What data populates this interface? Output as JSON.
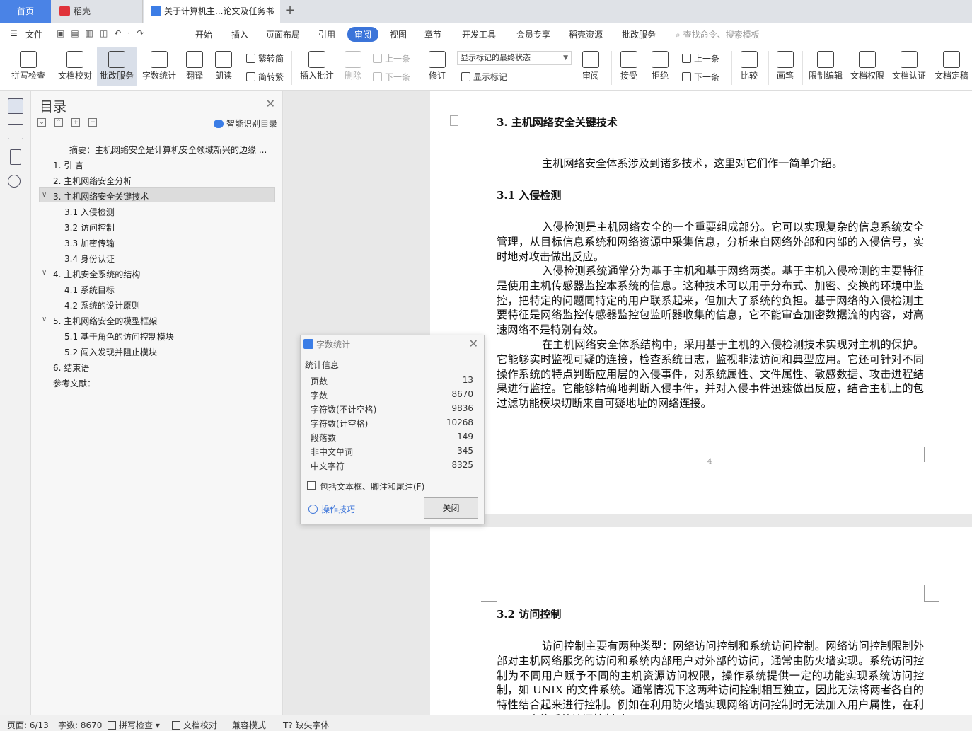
{
  "tabs": {
    "home": "首页",
    "daoke": "稻壳",
    "doc": "关于计算机主...论文及任务书",
    "close": "✕",
    "add": "+"
  },
  "menu": {
    "file": "文件",
    "items": [
      "开始",
      "插入",
      "页面布局",
      "引用",
      "审阅",
      "视图",
      "章节",
      "开发工具",
      "会员专享",
      "稻壳资源",
      "批改服务"
    ],
    "search": "查找命令、搜索模板"
  },
  "toolbar": {
    "spell": "拼写检查",
    "proof": "文档校对",
    "correction": "批改服务",
    "wordcount": "字数统计",
    "translate": "翻译",
    "read": "朗读",
    "trad_to_simp": "繁转简",
    "simp_to_trad": "简转繁",
    "insert_comment": "插入批注",
    "delete": "删除",
    "prev": "上一条",
    "next": "下一条",
    "revise": "修订",
    "mark_select": "显示标记的最终状态",
    "show_marks": "显示标记",
    "review": "审阅",
    "accept": "接受",
    "reject": "拒绝",
    "prev2": "上一条",
    "next2": "下一条",
    "compare": "比较",
    "pen": "画笔",
    "restrict": "限制编辑",
    "doc_perm": "文档权限",
    "doc_cert": "文档认证",
    "doc_final": "文档定稿"
  },
  "toc": {
    "title": "目录",
    "smart": "智能识别目录",
    "items": [
      "摘要：主机网络安全是计算机安全领域新兴的边缘 ...",
      "1. 引  言",
      "2. 主机网络安全分析",
      "3. 主机网络安全关键技术",
      "3.1    入侵检测",
      "3.2    访问控制",
      "3.3    加密传输",
      "3.4    身份认证",
      "4. 主机安全系统的结构",
      "4.1 系统目标",
      "4.2 系统的设计原则",
      "5. 主机网络安全的模型框架",
      "5.1  基于角色的访问控制模块",
      "5.2  闯入发现并阻止模块",
      "6. 结束语",
      "参考文献："
    ]
  },
  "doc": {
    "h3": "3.  主机网络安全关键技术",
    "intro": "主机网络安全体系涉及到诸多技术，这里对它们作一简单介绍。",
    "h31": "3.1    入侵检测",
    "p1": "入侵检测是主机网络安全的一个重要组成部分。它可以实现复杂的信息系统安全管理，从目标信息系统和网络资源中采集信息，分析来自网络外部和内部的入侵信号，实时地对攻击做出反应。",
    "p2": "入侵检测系统通常分为基于主机和基于网络两类。基于主机入侵检测的主要特征是使用主机传感器监控本系统的信息。这种技术可以用于分布式、加密、交换的环境中监控，把特定的问题同特定的用户联系起来，但加大了系统的负担。基于网络的入侵检测主要特征是网络监控传感器监控包监听器收集的信息，它不能审查加密数据流的内容，对高速网络不是特别有效。",
    "p3": "在主机网络安全体系结构中，采用基于主机的入侵检测技术实现对主机的保护。它能够实时监视可疑的连接，检查系统日志，监视非法访问和典型应用。它还可针对不同操作系统的特点判断应用层的入侵事件，对系统属性、文件属性、敏感数据、攻击进程结果进行监控。它能够精确地判断入侵事件，并对入侵事件迅速做出反应，结合主机上的包过滤功能模块切断来自可疑地址的网络连接。",
    "page_num": "4",
    "h32": "3.2    访问控制",
    "p4": "访问控制主要有两种类型：网络访问控制和系统访问控制。网络访问控制限制外部对主机网络服务的访问和系统内部用户对外部的访问，通常由防火墙实现。系统访问控制为不同用户赋予不同的主机资源访问权限，操作系统提供一定的功能实现系统访问控制，如 UNIX 的文件系统。通常情况下这两种访问控制相互独立，因此无法将两者各自的特性结合起来进行控制。例如在利用防火墙实现网络访问控制时无法加入用户属性，在利用……实施系统访问控制时……"
  },
  "dialog": {
    "title": "字数统计",
    "section": "统计信息",
    "rows": [
      {
        "label": "页数",
        "value": "13"
      },
      {
        "label": "字数",
        "value": "8670"
      },
      {
        "label": "字符数(不计空格)",
        "value": "9836"
      },
      {
        "label": "字符数(计空格)",
        "value": "10268"
      },
      {
        "label": "段落数",
        "value": "149"
      },
      {
        "label": "非中文单词",
        "value": "345"
      },
      {
        "label": "中文字符",
        "value": "8325"
      }
    ],
    "checkbox": "包括文本框、脚注和尾注(F)",
    "tips": "操作技巧",
    "close_btn": "关闭"
  },
  "status": {
    "page": "页面: 6/13",
    "words": "字数: 8670",
    "spell": "拼写检查",
    "proof": "文档校对",
    "compat": "兼容模式",
    "missing_font": "缺失字体"
  },
  "colors": {
    "accent": "#3b74d9",
    "home_tab": "#4a83e6"
  }
}
